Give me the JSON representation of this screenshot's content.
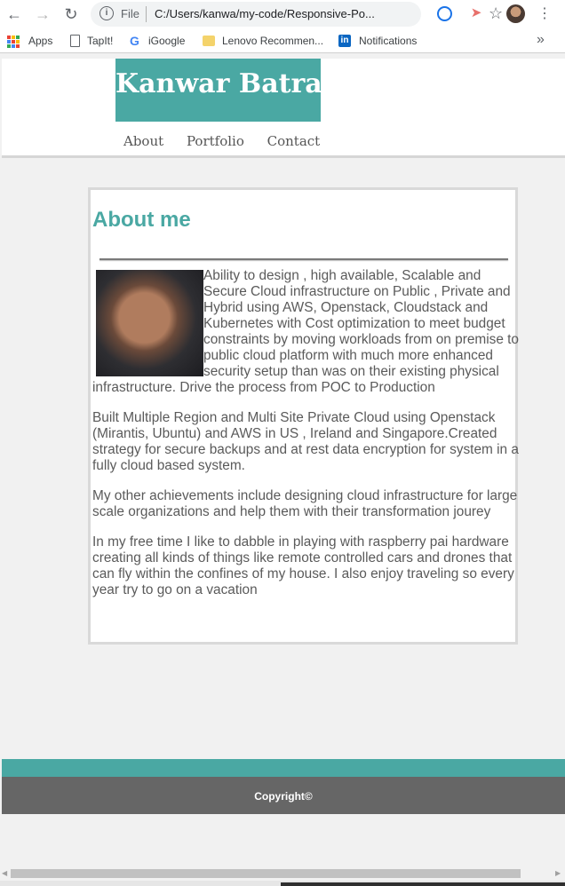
{
  "browser": {
    "url_scheme": "File",
    "url": "C:/Users/kanwa/my-code/Responsive-Po...",
    "bookmarks": [
      {
        "label": "Apps"
      },
      {
        "label": "TapIt!"
      },
      {
        "label": "iGoogle"
      },
      {
        "label": "Lenovo Recommen..."
      },
      {
        "label": "Notifications"
      }
    ],
    "bookmarks_more": "»"
  },
  "site": {
    "brand": "Kanwar Batra",
    "nav": [
      "About",
      "Portfolio",
      "Contact"
    ],
    "accent_color": "#4aa8a3"
  },
  "about": {
    "heading": "About me",
    "paragraphs": [
      "Ability to design , high available, Scalable and Secure Cloud infrastructure on Public , Private and Hybrid using AWS, Openstack, Cloudstack and Kubernetes with Cost optimization to meet budget constraints by moving workloads from on premise to public cloud platform with much more enhanced security setup than was on their existing physical infrastructure. Drive the process from POC to Production",
      "Built Multiple Region and Multi Site Private Cloud using Openstack (Mirantis, Ubuntu) and AWS in US , Ireland and Singapore.Created strategy for secure backups and at rest data encryption for system in a fully cloud based system.",
      "My other achievements include designing cloud infrastructure for large scale organizations and help them with their transformation jourey",
      "In my free time I like to dabble in playing with raspberry pai hardware creating all kinds of things like remote controlled cars and drones that can fly within the confines of my house. I also enjoy traveling so every year try to go on a vacation"
    ]
  },
  "footer": {
    "copyright": "Copyright©"
  }
}
